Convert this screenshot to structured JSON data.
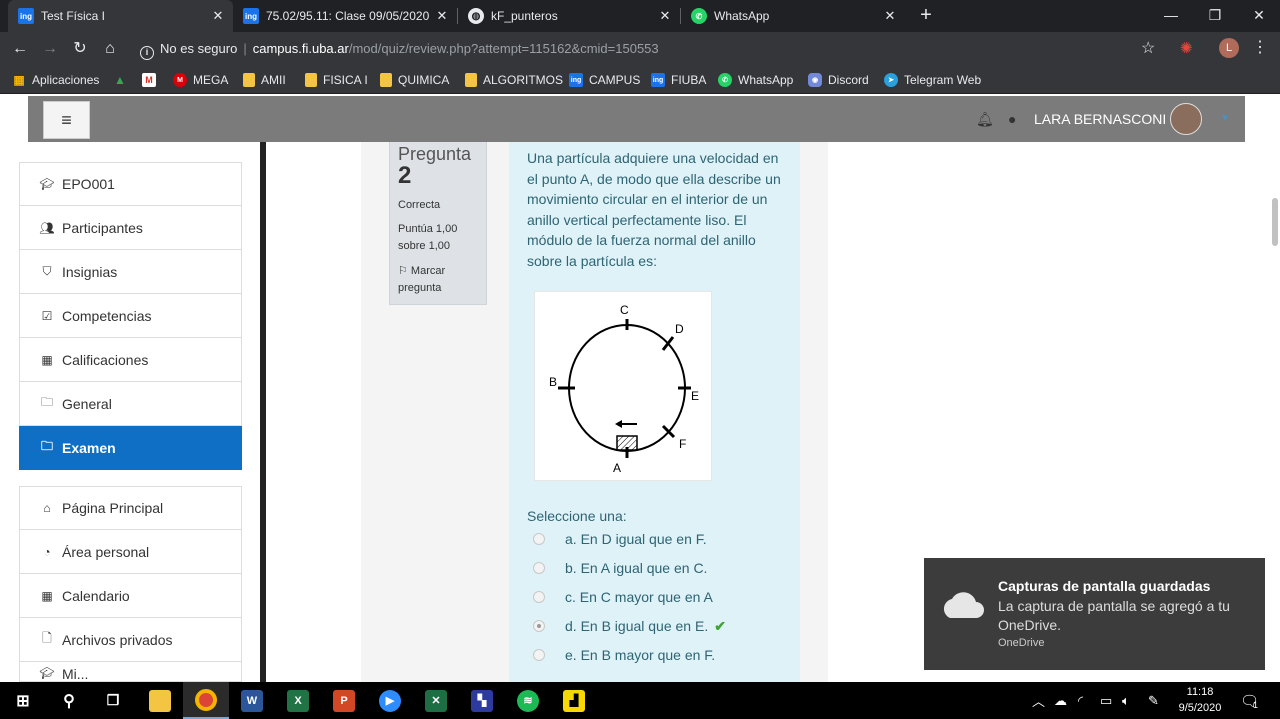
{
  "tabs": [
    {
      "title": "Test Física I",
      "favicon": "fiuba-ing-icon",
      "active": true
    },
    {
      "title": "75.02/95.11: Clase 09/05/2020",
      "favicon": "fiuba-ing-icon",
      "active": false
    },
    {
      "title": "kF_punteros",
      "favicon": "globe-icon",
      "active": false
    },
    {
      "title": "WhatsApp",
      "favicon": "whatsapp-icon",
      "active": false
    }
  ],
  "address": {
    "security": "No es seguro",
    "host": "campus.fi.uba.ar",
    "path": "/mod/quiz/review.php?attempt=115162&cmid=150553"
  },
  "avatar_letter": "L",
  "bookmarks": [
    "Aplicaciones",
    "",
    "",
    "MEGA",
    "AMII",
    "FISICA I",
    "QUIMICA",
    "ALGORITMOS",
    "CAMPUS",
    "FIUBA",
    "WhatsApp",
    "Discord",
    "Telegram Web"
  ],
  "user": {
    "name": "LARA BERNASCONI"
  },
  "sidebar": {
    "course": [
      {
        "label": "EPO001",
        "icon": "graduation-cap-icon"
      },
      {
        "label": "Participantes",
        "icon": "users-icon"
      },
      {
        "label": "Insignias",
        "icon": "shield-icon"
      },
      {
        "label": "Competencias",
        "icon": "checkbox-icon"
      },
      {
        "label": "Calificaciones",
        "icon": "table-icon"
      },
      {
        "label": "General",
        "icon": "folder-icon"
      },
      {
        "label": "Examen",
        "icon": "folder-icon",
        "active": true
      }
    ],
    "site": [
      {
        "label": "Página Principal",
        "icon": "home-icon"
      },
      {
        "label": "Área personal",
        "icon": "dashboard-icon"
      },
      {
        "label": "Calendario",
        "icon": "calendar-icon"
      },
      {
        "label": "Archivos privados",
        "icon": "file-icon"
      },
      {
        "label": "Mi...",
        "icon": "graduation-cap-icon"
      }
    ]
  },
  "question": {
    "heading": "Pregunta",
    "number": "2",
    "state": "Correcta",
    "grade": "Puntúa 1,00 sobre 1,00",
    "flag": "Marcar pregunta",
    "text": "Una partícula adquiere una velocidad en el punto A, de modo que ella describe un movimiento circular en el interior de un anillo vertical perfectamente liso. El módulo de la fuerza normal del anillo sobre la partícula es:",
    "figure_labels": {
      "a": "A",
      "b": "B",
      "c": "C",
      "d": "D",
      "e": "E",
      "f": "F"
    },
    "select_label": "Seleccione una:",
    "options": [
      {
        "text": "a. En D igual que en F.",
        "selected": false,
        "correct": false
      },
      {
        "text": "b. En A igual que en C.",
        "selected": false,
        "correct": false
      },
      {
        "text": "c. En C mayor que en A",
        "selected": false,
        "correct": false
      },
      {
        "text": "d. En B igual que en E.",
        "selected": true,
        "correct": true
      },
      {
        "text": "e. En B mayor que en F.",
        "selected": false,
        "correct": false
      }
    ]
  },
  "toast": {
    "title": "Capturas de pantalla guardadas",
    "body": "La captura de pantalla se agregó a tu OneDrive.",
    "source": "OneDrive"
  },
  "clock": {
    "time": "11:18",
    "date": "9/5/2020"
  },
  "notif_count": "1"
}
